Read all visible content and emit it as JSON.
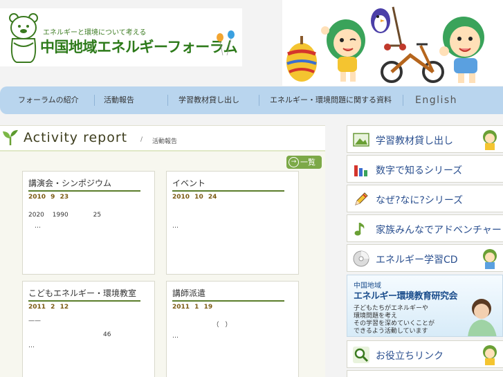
{
  "header": {
    "tagline": "エネルギーと環境について考える",
    "site_name": "中国地域エネルギーフォーラム"
  },
  "nav": [
    {
      "label": "フォーラムの紹介"
    },
    {
      "label": "活動報告"
    },
    {
      "label": "学習教材貸し出し"
    },
    {
      "label": "エネルギー・環境問題に関する資料"
    },
    {
      "label": "English"
    }
  ],
  "main": {
    "title": "Activity report",
    "crumb_sep": "/",
    "crumb": "活動報告",
    "list_button": "一覧",
    "list_button_icon": "→",
    "cards": [
      {
        "title": "講演会・シンポジウム",
        "date": "2010 9 23",
        "body1": "2020 　1990　　　　25",
        "body2": "　…"
      },
      {
        "title": "イベント",
        "date": "2010 10 24",
        "body1": "",
        "body2": "…"
      },
      {
        "title": "こどもエネルギー・環境教室",
        "date": "2011 2 12",
        "body1": "——",
        "body2": "　　　　　　　　　　　　46",
        "body3": "…"
      },
      {
        "title": "講師派遣",
        "date": "2011 1 19",
        "body1": "　　　　　　　（　）",
        "body2": "…"
      }
    ]
  },
  "sidebar": {
    "items": [
      {
        "label": "学習教材貸し出し",
        "icon": "picture-icon"
      },
      {
        "label": "数字で知るシリーズ",
        "icon": "bar-chart-icon"
      },
      {
        "label": "なぜ?なに?シリーズ",
        "icon": "pencil-icon"
      },
      {
        "label": "家族みんなでアドベンチャー",
        "icon": "music-note-icon"
      },
      {
        "label": "エネルギー学習CD",
        "icon": "cd-icon"
      },
      {
        "label": "お役立ちリンク",
        "icon": "magnifier-icon"
      }
    ],
    "banner": {
      "line1": "中国地域",
      "line2": "エネルギー環境教育研究会",
      "text1": "子どもたちがエネルギーや",
      "text2": "環境問題を考え",
      "text3": "その学習を深めていくことが",
      "text4": "できるよう活動しています"
    }
  },
  "colors": {
    "brand_green": "#2d7a1a",
    "nav_blue": "#b9d5ee",
    "link_blue": "#2a4f8f",
    "button_green": "#7ca947"
  }
}
